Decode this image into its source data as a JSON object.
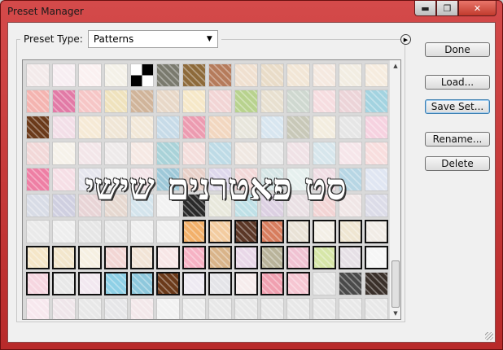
{
  "window": {
    "title": "Preset Manager"
  },
  "titlebar_buttons": {
    "minimize": "▬",
    "maximize": "❐",
    "close": "✕"
  },
  "preset": {
    "label": "Preset Type:",
    "value": "Patterns",
    "flyout_icon": "play-circle-icon"
  },
  "overlay_text": "סט פאטרנים שישי",
  "buttons": {
    "done": "Done",
    "load": "Load...",
    "save_set": "Save Set...",
    "rename": "Rename...",
    "delete": "Delete"
  },
  "patterns": [
    "#f3eaea",
    "#f7eef2",
    "#fbf1f1",
    "#f4f1e8",
    "checker",
    "#7a7a6e",
    "#8d6a3a",
    "#b57b5b",
    "#f0e0d0",
    "#e9dcc8",
    "#f2e6d6",
    "#f5e9e0",
    "#f2ede2",
    "#f6ecdf",
    "#f1ece2",
    "#f4b4b0",
    "#e27aa6",
    "#f6c6c6",
    "#efe2bd",
    "#d0b49a",
    "#e8d8c8",
    "#f6e8c8",
    "#f2d5d5",
    "#b8d28e",
    "#e8e0d0",
    "#cfd8d0",
    "#f6dde0",
    "#ecd4d8",
    "#a3d3e0",
    "#b8dbe8",
    "#6b3a1a",
    "#f3dfe8",
    "#f6ead6",
    "#f0e6d6",
    "#f2e8d8",
    "#c7dbe8",
    "#ec9bb0",
    "#f2d7c0",
    "#e8e6dc",
    "#d8e6f0",
    "#c8c8b8",
    "#f3eddf",
    "#e6e6e6",
    "#f6d2e0",
    "#cfe6ec",
    "#f2d8d8",
    "#f6f2ea",
    "#f3e6e9",
    "#eeeaea",
    "#f6e9e4",
    "#a9d2d8",
    "#f4dedc",
    "#bedbe6",
    "#f0e8e2",
    "#eaeaea",
    "#f0e2e6",
    "#d7e6ec",
    "#f6e6ea",
    "#f8dede",
    "#b85a8a",
    "#ee7fa4",
    "#f6dfe6",
    "#e6e6ee",
    "#f2f2f2",
    "#f3e4e8",
    "#9ec8d8",
    "#e8d0c8",
    "#ded8ec",
    "#f3d8d8",
    "#d6e6e6",
    "#e6f0ee",
    "#f0dde4",
    "#b7d6e4",
    "#e0e6f2",
    "#ece6f0",
    "#d8dce6",
    "#cfcfe0",
    "#e8d4d6",
    "#e6d8d0",
    "#d4e4ec",
    "#f2f2f2",
    "#2a2a2a",
    "#e8e8dc",
    "#bfe0e6",
    "#dcd0e2",
    "#eae0e4",
    "#f2d4d4",
    "#f0e6e6",
    "#dcdce8",
    "#e0e8ec",
    "#eaeaea",
    "#eeeeee",
    "#e6e6e6",
    "#e8e8e8",
    "#efefef",
    "#f0f0f0",
    "#f2b06a",
    "#f3cca0",
    "#5b3726",
    "#d77d5e",
    "#e9e2d6",
    "#f3efe6",
    "#efe6d2",
    "#f1ece6",
    "#efefef",
    "#f5e6c8",
    "#f2e6cc",
    "#f6f0e2",
    "#f2d6d4",
    "#f2e4d6",
    "#f7e6e6",
    "#f6b2c4",
    "#d9b48a",
    "#e9d8e8",
    "#b9b39a",
    "#f0c2d2",
    "#d6e6a8",
    "#e6e0e6",
    "#f6f6f6",
    "#f4f0e8",
    "#f6d6e0",
    "#e8e8e8",
    "#f2e8f0",
    "#8ed0e6",
    "#8ec8dc",
    "#6b3a1a",
    "#eeeaf2",
    "#e4e4e8",
    "#f6ecec",
    "#f0a0b0",
    "#f6c6d2",
    "#e6e6e6",
    "#4a4a4a",
    "#3a302a",
    "#d6d2cc",
    "#f7e8ee",
    "#efe6ea",
    "#e8e8e8",
    "#e6e6e8",
    "#f3e8ea",
    "#f2f2f2",
    "#ececec",
    "#e8e8e8",
    "#e8e8e8",
    "#e8e8e8",
    "#e8e8e8",
    "#e8e8e8",
    "#e8e8e8",
    "#e8e8e8",
    "#e8e8e8"
  ],
  "selected_from": 96
}
